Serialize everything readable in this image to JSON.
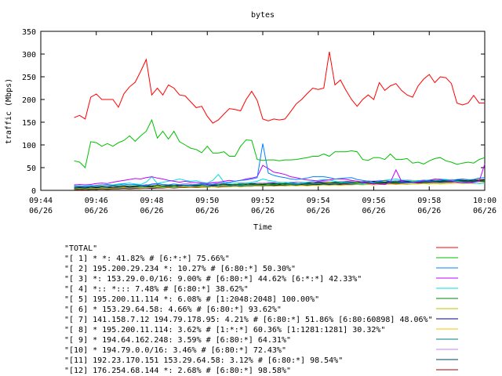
{
  "chart_data": {
    "type": "line",
    "title": "bytes",
    "xlabel": "Time",
    "ylabel": "traffic (Mbps)",
    "ylim": [
      0,
      350
    ],
    "yticks": [
      0,
      50,
      100,
      150,
      200,
      250,
      300,
      350
    ],
    "xlim": [
      "09:44",
      "10:00"
    ],
    "xticks": [
      {
        "time": "09:44",
        "date": "06/26"
      },
      {
        "time": "09:46",
        "date": "06/26"
      },
      {
        "time": "09:48",
        "date": "06/26"
      },
      {
        "time": "09:50",
        "date": "06/26"
      },
      {
        "time": "09:52",
        "date": "06/26"
      },
      {
        "time": "09:54",
        "date": "06/26"
      },
      {
        "time": "09:56",
        "date": "06/26"
      },
      {
        "time": "09:58",
        "date": "06/26"
      },
      {
        "time": "10:00",
        "date": "06/26"
      }
    ],
    "grid": false,
    "legend_position": "bottom",
    "x": [
      "09:45:12",
      "09:45:24",
      "09:45:36",
      "09:45:48",
      "09:46:00",
      "09:46:12",
      "09:46:24",
      "09:46:36",
      "09:46:48",
      "09:47:00",
      "09:47:12",
      "09:47:24",
      "09:47:36",
      "09:47:48",
      "09:48:00",
      "09:48:12",
      "09:48:24",
      "09:48:36",
      "09:48:48",
      "09:49:00",
      "09:49:12",
      "09:49:24",
      "09:49:36",
      "09:49:48",
      "09:50:00",
      "09:50:12",
      "09:50:24",
      "09:50:36",
      "09:50:48",
      "09:51:00",
      "09:51:12",
      "09:51:24",
      "09:51:36",
      "09:51:48",
      "09:52:00",
      "09:52:12",
      "09:52:24",
      "09:52:36",
      "09:52:48",
      "09:53:00",
      "09:53:12",
      "09:53:24",
      "09:53:36",
      "09:53:48",
      "09:54:00",
      "09:54:12",
      "09:54:24",
      "09:54:36",
      "09:54:48",
      "09:55:00",
      "09:55:12",
      "09:55:24",
      "09:55:36",
      "09:55:48",
      "09:56:00",
      "09:56:12",
      "09:56:24",
      "09:56:36",
      "09:56:48",
      "09:57:00",
      "09:57:12",
      "09:57:24",
      "09:57:36",
      "09:57:48",
      "09:58:00",
      "09:58:12",
      "09:58:24",
      "09:58:36",
      "09:58:48",
      "09:59:00",
      "09:59:12",
      "09:59:24",
      "09:59:36",
      "09:59:48",
      "10:00:00"
    ],
    "series": [
      {
        "name": "\"TOTAL\"",
        "color": "#ff0000",
        "values": [
          160,
          165,
          157,
          205,
          212,
          200,
          200,
          200,
          183,
          213,
          228,
          238,
          262,
          288,
          210,
          225,
          210,
          232,
          225,
          210,
          208,
          195,
          182,
          185,
          163,
          148,
          155,
          168,
          180,
          178,
          175,
          200,
          218,
          198,
          157,
          153,
          157,
          155,
          157,
          173,
          190,
          200,
          213,
          225,
          222,
          225,
          305,
          232,
          243,
          220,
          200,
          185,
          200,
          210,
          200,
          237,
          220,
          230,
          235,
          220,
          210,
          205,
          230,
          245,
          255,
          237,
          250,
          248,
          235,
          192,
          188,
          192,
          209,
          192,
          192
        ]
      },
      {
        "name": "\"[ 1] * *: 41.82% # [6:*:*] 75.66%\"",
        "color": "#00c000",
        "values": [
          65,
          62,
          50,
          107,
          105,
          97,
          103,
          97,
          105,
          110,
          120,
          108,
          120,
          130,
          155,
          115,
          130,
          113,
          130,
          107,
          100,
          93,
          90,
          83,
          97,
          82,
          82,
          85,
          75,
          75,
          97,
          111,
          110,
          68,
          66,
          67,
          67,
          65,
          67,
          67,
          68,
          70,
          72,
          75,
          75,
          80,
          75,
          85,
          85,
          85,
          87,
          85,
          68,
          66,
          72,
          72,
          68,
          80,
          68,
          68,
          70,
          60,
          62,
          58,
          65,
          70,
          72,
          65,
          62,
          57,
          60,
          62,
          60,
          68,
          72
        ]
      },
      {
        "name": "\"[ 2] 195.200.29.234 *: 10.27% # [6:80:*] 50.30%\"",
        "color": "#0080ff",
        "values": [
          10,
          9,
          8,
          9,
          11,
          12,
          12,
          11,
          12,
          14,
          12,
          13,
          11,
          10,
          14,
          15,
          13,
          12,
          14,
          12,
          12,
          11,
          13,
          14,
          12,
          13,
          15,
          17,
          18,
          20,
          22,
          23,
          25,
          28,
          103,
          38,
          33,
          30,
          28,
          25,
          24,
          25,
          27,
          30,
          30,
          30,
          28,
          25,
          26,
          27,
          28,
          24,
          22,
          20,
          18,
          20,
          22,
          20,
          20,
          18,
          17,
          18,
          20,
          22,
          20,
          21,
          22,
          23,
          22,
          24,
          25,
          23,
          24,
          27,
          28
        ]
      },
      {
        "name": "\"[ 3] *: 153.29.0.0/16: 9.00% # [6:80:*] 44.62% [6:*:*] 42.33%\"",
        "color": "#c000ff",
        "values": [
          12,
          13,
          12,
          13,
          15,
          16,
          15,
          18,
          20,
          22,
          24,
          26,
          25,
          28,
          30,
          27,
          25,
          22,
          20,
          18,
          20,
          18,
          17,
          16,
          15,
          17,
          18,
          20,
          22,
          20,
          22,
          25,
          27,
          30,
          55,
          48,
          40,
          38,
          35,
          30,
          28,
          25,
          23,
          22,
          20,
          22,
          23,
          25,
          25,
          24,
          22,
          20,
          18,
          16,
          15,
          14,
          13,
          18,
          45,
          20,
          18,
          17,
          18,
          20,
          22,
          25,
          24,
          22,
          20,
          18,
          17,
          16,
          18,
          20,
          58
        ]
      },
      {
        "name": "\"[ 4] *:: *::: 7.48% # [6:80:*] 38.62%\"",
        "color": "#00e0e0",
        "values": [
          8,
          9,
          10,
          10,
          11,
          12,
          13,
          12,
          14,
          15,
          16,
          14,
          13,
          18,
          30,
          15,
          18,
          20,
          22,
          25,
          22,
          20,
          21,
          18,
          16,
          22,
          35,
          18,
          15,
          16,
          15,
          16,
          18,
          20,
          25,
          22,
          20,
          18,
          17,
          16,
          15,
          16,
          18,
          20,
          22,
          24,
          23,
          20,
          18,
          17,
          16,
          15,
          14,
          16,
          18,
          20,
          22,
          24,
          25,
          23,
          22,
          20,
          21,
          22,
          23,
          24,
          25,
          24,
          22,
          20,
          18,
          17,
          16,
          15,
          16
        ]
      },
      {
        "name": "\"[ 5] 195.200.11.114 *: 6.08% # [1:2048:2048] 100.00%\"",
        "color": "#008000",
        "values": [
          7,
          8,
          7,
          8,
          8,
          9,
          8,
          9,
          9,
          10,
          9,
          10,
          10,
          11,
          10,
          11,
          10,
          11,
          11,
          12,
          11,
          12,
          11,
          12,
          12,
          13,
          12,
          13,
          12,
          13,
          13,
          14,
          13,
          14,
          14,
          15,
          14,
          15,
          14,
          15,
          15,
          16,
          15,
          16,
          15,
          16,
          16,
          17,
          16,
          17,
          16,
          17,
          17,
          18,
          17,
          18,
          17,
          18,
          18,
          19,
          18,
          19,
          18,
          19,
          19,
          20,
          19,
          20,
          19,
          20,
          20,
          21,
          20,
          21,
          20
        ]
      },
      {
        "name": "\"[ 6] * 153.29.64.58: 4.66% # [6:80:*] 93.62%\"",
        "color": "#c0c000",
        "values": [
          3,
          4,
          3,
          4,
          4,
          5,
          4,
          5,
          5,
          6,
          5,
          6,
          5,
          6,
          6,
          7,
          6,
          7,
          6,
          7,
          7,
          8,
          7,
          8,
          7,
          8,
          8,
          9,
          8,
          9,
          8,
          9,
          9,
          10,
          9,
          10,
          9,
          10,
          10,
          11,
          10,
          11,
          10,
          11,
          11,
          12,
          11,
          12,
          11,
          12,
          12,
          13,
          12,
          13,
          12,
          13,
          13,
          14,
          13,
          14,
          13,
          14,
          14,
          15,
          14,
          15,
          14,
          15,
          15,
          16,
          15,
          16,
          15,
          16,
          16
        ]
      },
      {
        "name": "\"[ 7] 141.158.7.12 194.79.178.95: 4.21% # [6:80:*] 51.86% [6:80:60898] 48.06%\"",
        "color": "#000080",
        "values": [
          5,
          6,
          5,
          7,
          6,
          8,
          7,
          6,
          8,
          9,
          7,
          8,
          10,
          9,
          8,
          12,
          10,
          9,
          11,
          10,
          12,
          11,
          10,
          12,
          13,
          11,
          12,
          14,
          13,
          12,
          14,
          13,
          15,
          14,
          13,
          15,
          16,
          14,
          15,
          17,
          16,
          15,
          17,
          16,
          18,
          17,
          16,
          18,
          17,
          19,
          18,
          17,
          19,
          18,
          20,
          19,
          18,
          20,
          19,
          21,
          20,
          19,
          21,
          20,
          22,
          21,
          20,
          22,
          21,
          23,
          22,
          21,
          23,
          22,
          24
        ]
      },
      {
        "name": "\"[ 8] * 195.200.11.114: 3.62% # [1:*:*] 60.36% [1:1281:1281] 30.32%\"",
        "color": "#ffc000",
        "values": [
          6,
          6,
          7,
          6,
          7,
          7,
          8,
          7,
          8,
          8,
          9,
          8,
          9,
          9,
          10,
          9,
          10,
          10,
          11,
          10,
          11,
          11,
          12,
          11,
          12,
          12,
          13,
          12,
          13,
          13,
          14,
          13,
          14,
          14,
          15,
          14,
          15,
          15,
          16,
          15,
          16,
          16,
          17,
          16,
          17,
          17,
          18,
          17,
          18,
          18,
          19,
          18,
          19,
          19,
          20,
          19,
          20,
          20,
          21,
          20,
          21,
          21,
          22,
          21,
          22,
          22,
          23,
          22,
          23,
          23,
          24,
          23,
          24,
          24,
          25
        ]
      },
      {
        "name": "\"[ 9] * 194.64.162.248: 3.59% # [6:80:*] 64.31%\"",
        "color": "#008080",
        "values": [
          4,
          5,
          4,
          5,
          5,
          6,
          5,
          6,
          6,
          7,
          6,
          7,
          7,
          8,
          7,
          8,
          8,
          9,
          8,
          9,
          9,
          10,
          9,
          10,
          10,
          11,
          10,
          11,
          11,
          12,
          11,
          12,
          12,
          13,
          12,
          13,
          13,
          14,
          13,
          14,
          14,
          15,
          14,
          15,
          15,
          16,
          15,
          16,
          16,
          17,
          16,
          17,
          17,
          18,
          17,
          18,
          18,
          19,
          18,
          19,
          19,
          20,
          19,
          20,
          20,
          21,
          20,
          21,
          21,
          22,
          21,
          22,
          22,
          23,
          22
        ]
      },
      {
        "name": "\"[10] * 194.79.0.0/16: 3.46% # [6:80:*] 72.43%\"",
        "color": "#c080ff",
        "values": [
          9,
          10,
          9,
          11,
          10,
          12,
          11,
          10,
          12,
          11,
          13,
          12,
          11,
          13,
          12,
          14,
          13,
          12,
          14,
          13,
          15,
          14,
          13,
          15,
          14,
          16,
          15,
          14,
          16,
          15,
          17,
          16,
          15,
          17,
          16,
          18,
          17,
          16,
          18,
          17,
          19,
          18,
          17,
          19,
          18,
          20,
          19,
          18,
          20,
          19,
          21,
          20,
          19,
          21,
          20,
          22,
          21,
          20,
          22,
          21,
          23,
          22,
          21,
          23,
          22,
          24,
          23,
          22,
          24,
          23,
          25,
          24,
          23,
          25,
          24
        ]
      },
      {
        "name": "\"[11] 192.23.170.151 153.29.64.58: 3.12% # [6:80:*] 98.54%\"",
        "color": "#004060",
        "values": [
          2,
          3,
          2,
          3,
          3,
          4,
          3,
          4,
          4,
          5,
          4,
          5,
          5,
          6,
          5,
          6,
          6,
          7,
          6,
          7,
          7,
          8,
          7,
          8,
          8,
          9,
          8,
          9,
          9,
          10,
          9,
          10,
          10,
          11,
          10,
          11,
          11,
          12,
          11,
          12,
          12,
          13,
          12,
          13,
          13,
          14,
          13,
          14,
          14,
          15,
          14,
          15,
          15,
          16,
          15,
          16,
          16,
          17,
          16,
          17,
          17,
          18,
          17,
          18,
          18,
          19,
          18,
          19,
          19,
          20,
          19,
          20,
          20,
          21,
          20
        ]
      },
      {
        "name": "\"[12] 176.254.68.144 *: 2.68% # [6:80:*] 98.58%\"",
        "color": "#a00000",
        "values": [
          1,
          2,
          1,
          2,
          2,
          3,
          2,
          3,
          3,
          4,
          3,
          4,
          4,
          5,
          4,
          5,
          5,
          6,
          5,
          6,
          6,
          7,
          6,
          7,
          7,
          8,
          7,
          8,
          8,
          9,
          8,
          9,
          9,
          10,
          9,
          10,
          10,
          11,
          10,
          11,
          11,
          12,
          11,
          12,
          12,
          13,
          12,
          13,
          13,
          14,
          13,
          14,
          14,
          15,
          14,
          15,
          15,
          16,
          15,
          16,
          16,
          17,
          16,
          17,
          17,
          18,
          17,
          18,
          18,
          19,
          18,
          19,
          19,
          20,
          19
        ]
      }
    ]
  }
}
